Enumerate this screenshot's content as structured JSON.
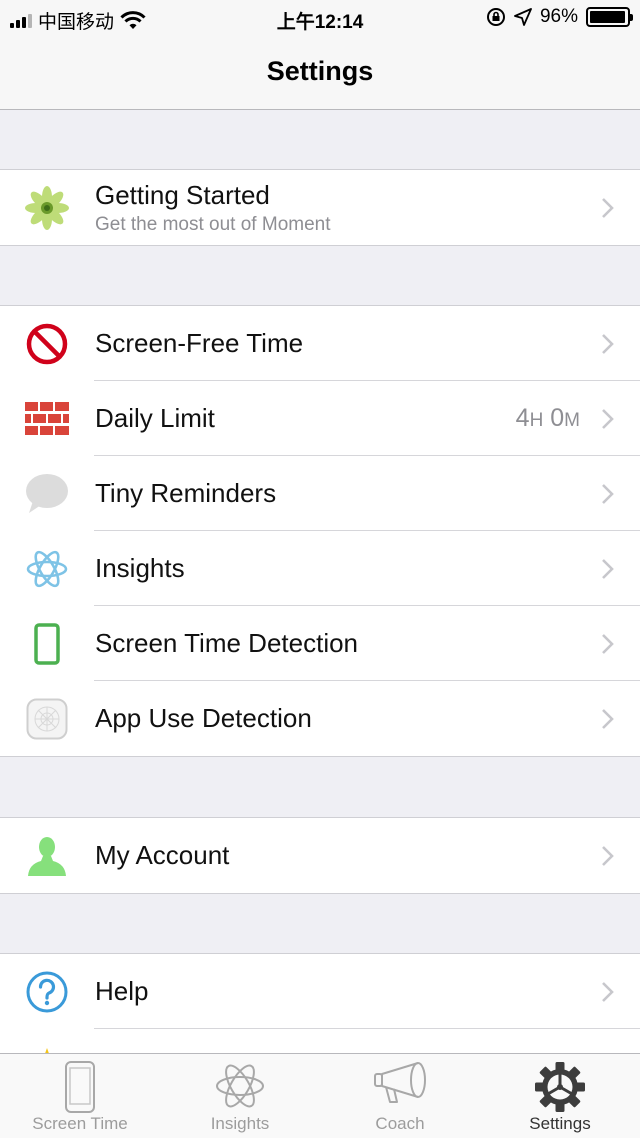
{
  "status_bar": {
    "carrier": "中国移动",
    "time": "上午12:14",
    "battery": "96%",
    "battery_level": 0.96
  },
  "nav": {
    "title": "Settings"
  },
  "getting_started": {
    "title": "Getting Started",
    "subtitle": "Get the most out of Moment"
  },
  "features": {
    "screen_free_time": "Screen-Free Time",
    "daily_limit": "Daily Limit",
    "daily_limit_hours": "4",
    "daily_limit_h_unit": "H",
    "daily_limit_minutes": "0",
    "daily_limit_m_unit": "M",
    "tiny_reminders": "Tiny Reminders",
    "insights": "Insights",
    "screen_time_detection": "Screen Time Detection",
    "app_use_detection": "App Use Detection"
  },
  "account": {
    "my_account": "My Account"
  },
  "support": {
    "help": "Help"
  },
  "tabs": [
    {
      "label": "Screen Time",
      "icon": "phone-icon"
    },
    {
      "label": "Insights",
      "icon": "atom-icon"
    },
    {
      "label": "Coach",
      "icon": "megaphone-icon"
    },
    {
      "label": "Settings",
      "icon": "gear-icon"
    }
  ],
  "colors": {
    "no_sign_red": "#d0021b",
    "brick_red": "#d9443a",
    "green": "#4cb050",
    "account_green": "#86e07c",
    "help_blue": "#3a9ad9",
    "chevron": "#c7c7cc"
  }
}
